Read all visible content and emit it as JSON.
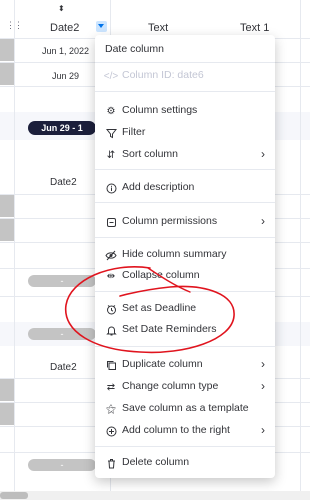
{
  "header": {
    "col_date": "Date2",
    "col_text": "Text",
    "col_text1": "Text 1"
  },
  "cells": {
    "date_row1": "Jun 1, 2022",
    "date_row2": "Jun 29",
    "group2_pill": "Jun 29 - 1",
    "group2_col": "Date2",
    "group2_pill_empty": "-",
    "group3_pill_empty": "-",
    "group3_col": "Date2",
    "group4_pill_empty": "-"
  },
  "menu": {
    "title": "Date column",
    "column_id": "Column ID: date6",
    "items": [
      {
        "label": "Column settings",
        "icon": "gear-icon"
      },
      {
        "label": "Filter",
        "icon": "filter-icon"
      },
      {
        "label": "Sort column",
        "icon": "sort-icon",
        "submenu": true
      },
      {
        "label": "Add description",
        "icon": "info-icon"
      },
      {
        "label": "Column permissions",
        "icon": "lock-icon",
        "submenu": true
      },
      {
        "label": "Hide column summary",
        "icon": "eye-icon"
      },
      {
        "label": "Collapse column",
        "icon": "collapse-icon"
      },
      {
        "label": "Set as Deadline",
        "icon": "deadline-icon"
      },
      {
        "label": "Set Date Reminders",
        "icon": "bell-icon"
      },
      {
        "label": "Duplicate column",
        "icon": "duplicate-icon",
        "submenu": true
      },
      {
        "label": "Change column type",
        "icon": "change-type-icon",
        "submenu": true
      },
      {
        "label": "Save column as a template",
        "icon": "magic-icon"
      },
      {
        "label": "Add column to the right",
        "icon": "add-icon",
        "submenu": true
      },
      {
        "label": "Delete column",
        "icon": "trash-icon"
      }
    ]
  },
  "colors": {
    "annotation": "#e0141e",
    "accent": "#0073ea",
    "pill_dark": "#1c1f3b"
  }
}
